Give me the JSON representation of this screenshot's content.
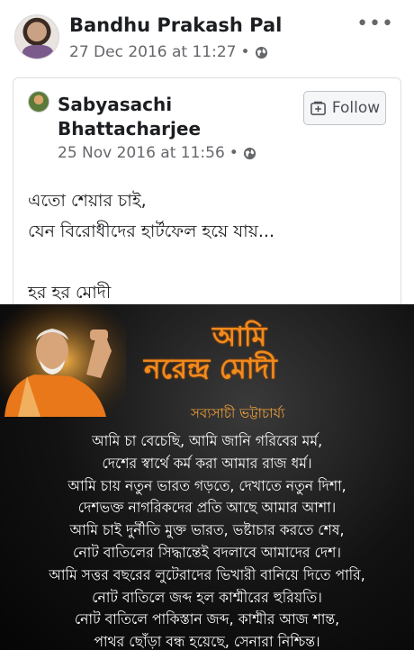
{
  "post": {
    "author": "Bandhu Prakash Pal",
    "timestamp": "27 Dec 2016 at 11:27",
    "separator": "•",
    "more_label": "•••"
  },
  "shared_post": {
    "author": "Sabyasachi Bhattacharjee",
    "timestamp": "25 Nov 2016 at 11:56",
    "separator": "•",
    "follow_label": "Follow",
    "text_lines": [
      "এতো শেয়ার চাই,",
      "যেন বিরোধীদের হার্টফেল হয়ে যায়...",
      "",
      "হর হর মোদী"
    ]
  },
  "poster": {
    "title_line1": "আমি",
    "title_line2": "নরেন্দ্র মোদী",
    "author": "সব্যসাচী ভট্টাচার্য্য",
    "lines": [
      "আমি চা বেচেছি, আমি জানি গরিবের মর্ম,",
      "দেশের স্বার্থে কর্ম করা আমার রাজ ধর্ম।",
      "আমি চায় নতুন ভারত গড়তে, দেখাতে নতুন দিশা,",
      "দেশভক্ত নাগরিকদের প্রতি আছে আমার আশা।",
      "আমি চাই দুর্নীতি মুক্ত ভারত, ভষ্টাচার করতে শেষ,",
      "নোট বাতিলের সিদ্ধান্তেই বদলাবে আমাদের দেশ।",
      "আমি সত্তর বছরের লুটেরাদের ভিখারী বানিয়ে দিতে পারি,",
      "নোট বাতিলে জব্দ হল কাশ্মীরের হুরিয়তি।",
      "নোট বাতিলে পাকিস্তান জব্দ, কাশ্মীর আজ শান্ত,",
      "পাথর ছোঁড়া বন্ধ হয়েছে, সেনারা নিশ্চিন্ত।"
    ]
  },
  "colors": {
    "name": "#1c1e21",
    "meta": "#65676b",
    "poster_accent": "#f28a1c",
    "poster_bg": "#0f0f0f"
  },
  "icons": [
    "globe-icon",
    "more-icon",
    "follow-icon"
  ]
}
